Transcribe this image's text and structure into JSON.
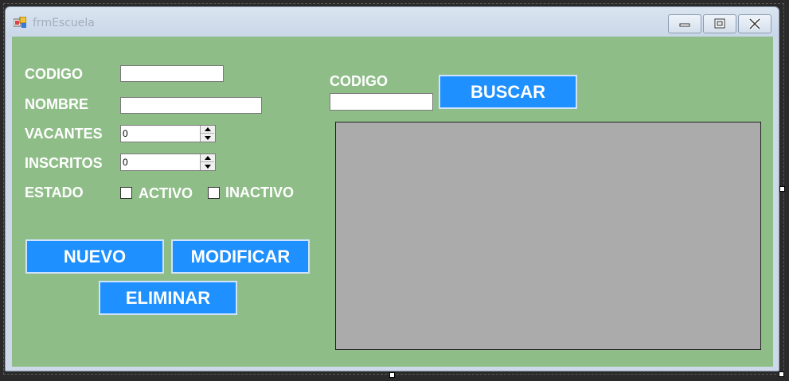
{
  "window": {
    "title": "frmEscuela",
    "icon": "form-icon",
    "controls": [
      "minimize-icon",
      "maximize-icon",
      "close-icon"
    ]
  },
  "form": {
    "codigo_label": "CODIGO",
    "codigo_value": "",
    "nombre_label": "NOMBRE",
    "nombre_value": "",
    "vacantes_label": "VACANTES",
    "vacantes_value": "0",
    "inscritos_label": "INSCRITOS",
    "inscritos_value": "0",
    "estado_label": "ESTADO",
    "activo_label": "ACTIVO",
    "activo_checked": false,
    "inactivo_label": "INACTIVO",
    "inactivo_checked": false
  },
  "buttons": {
    "nuevo": "NUEVO",
    "modificar": "MODIFICAR",
    "eliminar": "ELIMINAR",
    "buscar": "BUSCAR"
  },
  "search": {
    "codigo_label": "CODIGO",
    "codigo_value": ""
  },
  "colors": {
    "client_bg": "#8fbd88",
    "button_bg": "#1e90ff",
    "grid_bg": "#ababab"
  }
}
